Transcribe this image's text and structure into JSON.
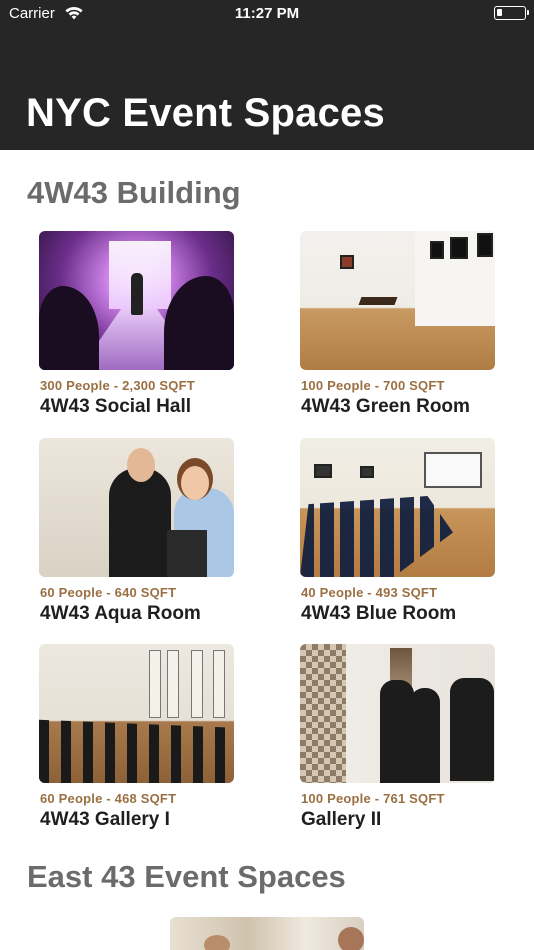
{
  "status_bar": {
    "carrier": "Carrier",
    "time": "11:27 PM"
  },
  "nav": {
    "title": "NYC Event Spaces"
  },
  "sections": [
    {
      "title": "4W43  Building",
      "cards": [
        {
          "meta": "300 People - 2,300 SQFT",
          "name": "4W43 Social Hall"
        },
        {
          "meta": "100 People - 700 SQFT",
          "name": "4W43 Green Room"
        },
        {
          "meta": "60 People - 640 SQFT",
          "name": "4W43 Aqua Room"
        },
        {
          "meta": "40 People - 493 SQFT",
          "name": "4W43 Blue Room"
        },
        {
          "meta": "60 People - 468 SQFT",
          "name": "4W43 Gallery I"
        },
        {
          "meta": "100 People - 761 SQFT",
          "name": "Gallery II"
        }
      ]
    },
    {
      "title": "East 43 Event Spaces"
    }
  ],
  "icons": {
    "wifi": "wifi-icon",
    "battery": "battery-icon"
  }
}
